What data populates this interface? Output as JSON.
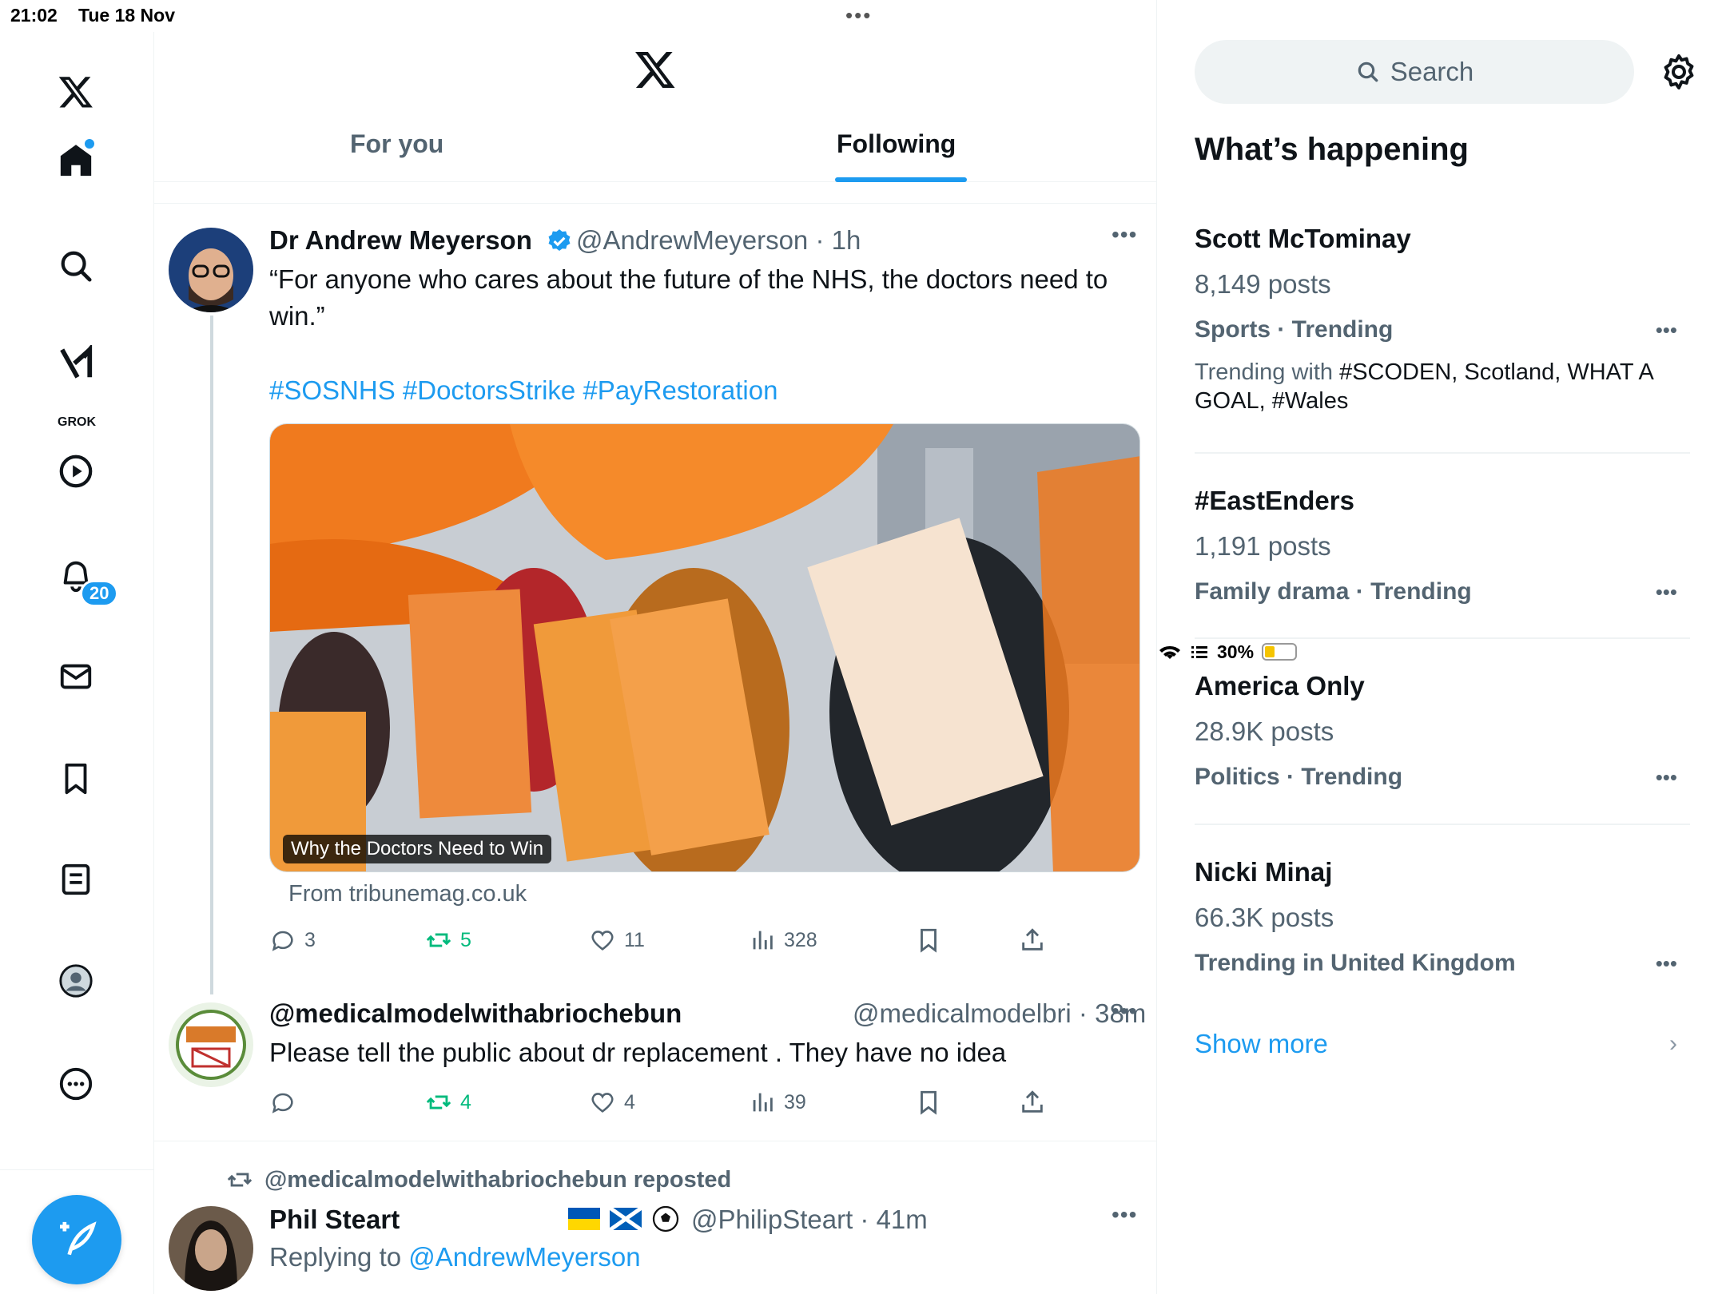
{
  "status_bar": {
    "time": "21:02",
    "date": "Tue 18 Nov",
    "battery_percent": "30%",
    "battery_level": 0.3
  },
  "left_nav": {
    "items": [
      "x-logo",
      "home-icon",
      "search-icon",
      "grok-icon",
      "video-icon",
      "notifications-icon",
      "messages-icon",
      "bookmarks-icon",
      "lists-icon",
      "profile-icon",
      "more-icon"
    ],
    "grok_label": "GROK",
    "notifications_count": "20"
  },
  "header": {
    "tabs": [
      {
        "label": "For you",
        "active": false
      },
      {
        "label": "Following",
        "active": true
      }
    ]
  },
  "tweets": [
    {
      "name": "Dr Andrew Meyerson",
      "verified": true,
      "handle_time": "@AndrewMeyerson · 1h",
      "text": "“For anyone who cares about the future of the NHS, the doctors need to win.”",
      "hashtags": "#SOSNHS #DoctorsStrike #PayRestoration",
      "media_caption": "Why the Doctors Need to Win",
      "link_source": "From tribunemag.co.uk",
      "replies": "3",
      "reposts": "5",
      "likes": "11",
      "views": "328"
    },
    {
      "name": "@medicalmodelwithabriochebun",
      "handle_time": "@medicalmodelbri · 38m",
      "text": "Please tell the public about dr replacement . They have no idea",
      "replies": "",
      "reposts": "4",
      "likes": "4",
      "views": "39"
    },
    {
      "repost_label": "@medicalmodelwithabriochebun reposted",
      "name": "Phil Steart",
      "handle_time": "@PhilipSteart · 41m",
      "replying_prefix": "Replying to",
      "replying_to": "@AndrewMeyerson"
    }
  ],
  "sidebar": {
    "search_placeholder": "Search",
    "heading": "What’s happening",
    "trends": [
      {
        "name": "Scott McTominay",
        "posts": "8,149 posts",
        "context": "Sports · Trending",
        "with_prefix": "Trending with",
        "with": "#SCODEN, Scotland, WHAT A GOAL, #Wales"
      },
      {
        "name": "#EastEnders",
        "posts": "1,191 posts",
        "context": "Family drama · Trending"
      },
      {
        "name": "America Only",
        "posts": "28.9K posts",
        "context": "Politics · Trending"
      },
      {
        "name": "Nicki Minaj",
        "posts": "66.3K posts",
        "context": "Trending in United Kingdom"
      }
    ],
    "show_more": "Show more"
  },
  "colors": {
    "accent": "#1d9bf0",
    "repost_green": "#00ba7c",
    "muted": "#536471"
  }
}
